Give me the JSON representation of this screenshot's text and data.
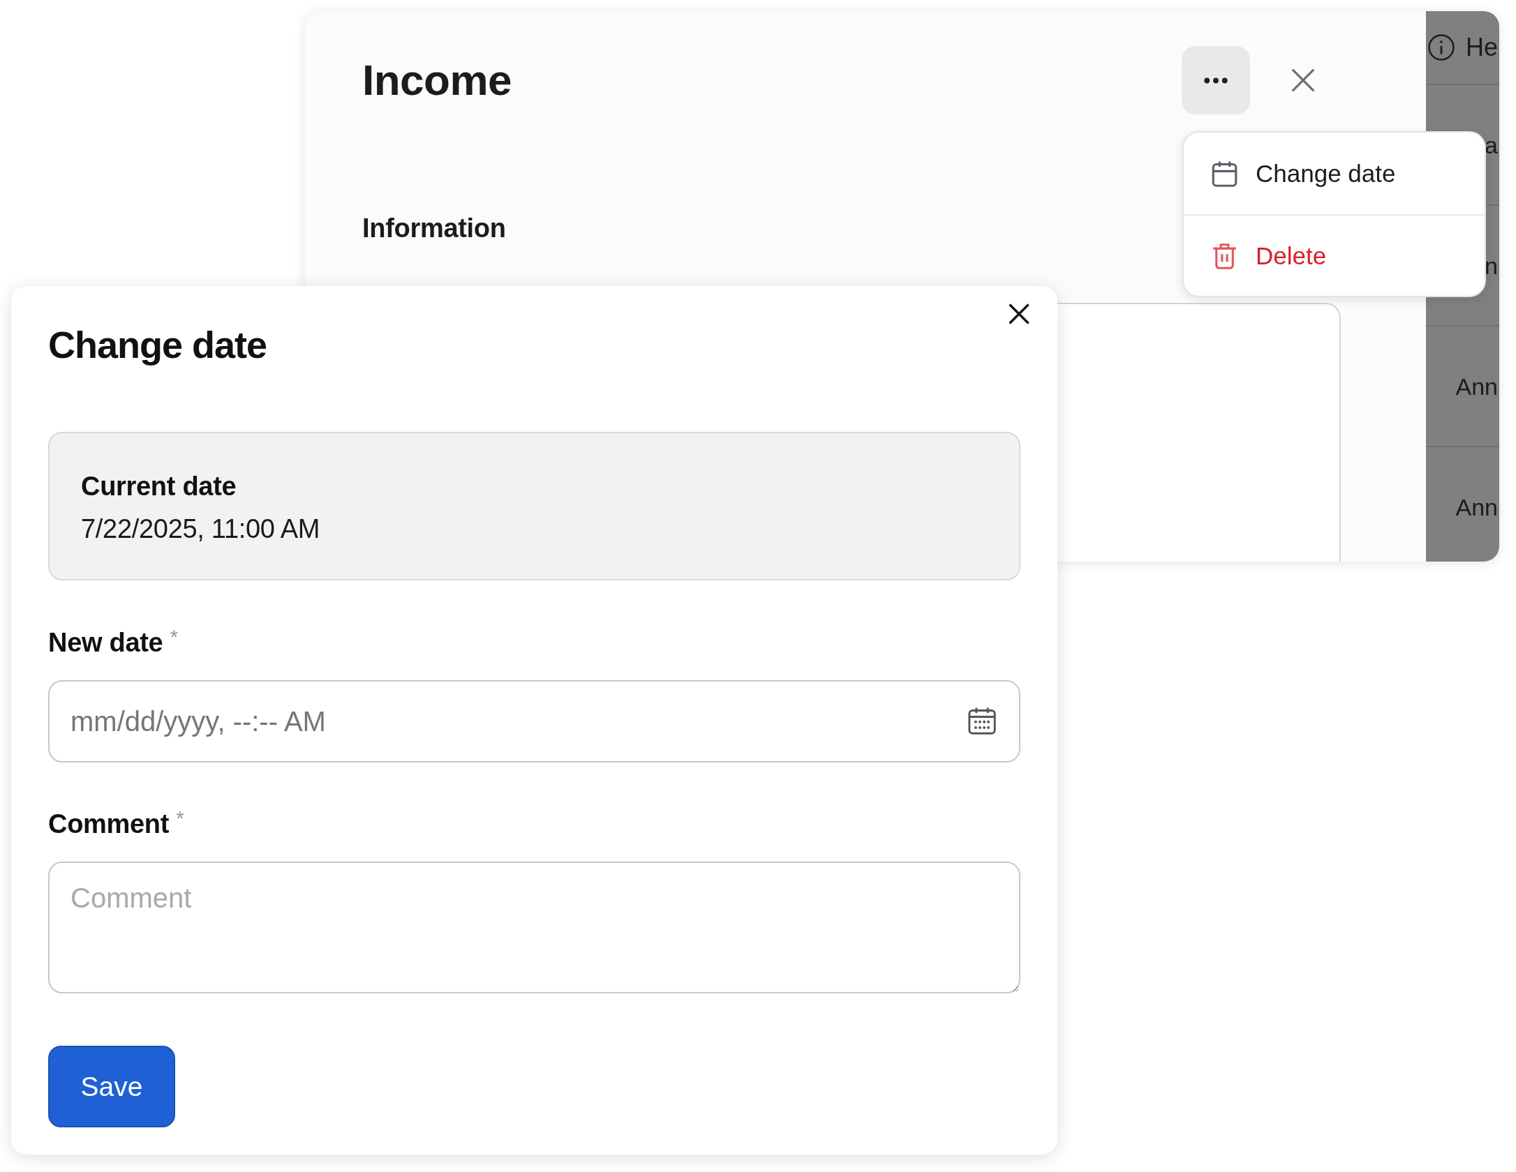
{
  "background_panel": {
    "title": "Income",
    "section_heading": "Information"
  },
  "side_table": {
    "header": "He",
    "cells": [
      "a",
      "n",
      "Ann",
      "Ann"
    ]
  },
  "menu": {
    "items": [
      {
        "kind": "normal",
        "label": "Change date"
      },
      {
        "kind": "danger",
        "label": "Delete"
      }
    ]
  },
  "dialog": {
    "title": "Change date",
    "current_date": {
      "label": "Current date",
      "value": "7/22/2025, 11:00 AM"
    },
    "fields": [
      {
        "kind": "datetime",
        "label": "New date",
        "required_mark": "*",
        "placeholder": "mm/dd/yyyy, --:-- AM"
      },
      {
        "kind": "textarea",
        "label": "Comment",
        "required_mark": "*",
        "placeholder": "Comment"
      }
    ],
    "save_button": "Save"
  }
}
